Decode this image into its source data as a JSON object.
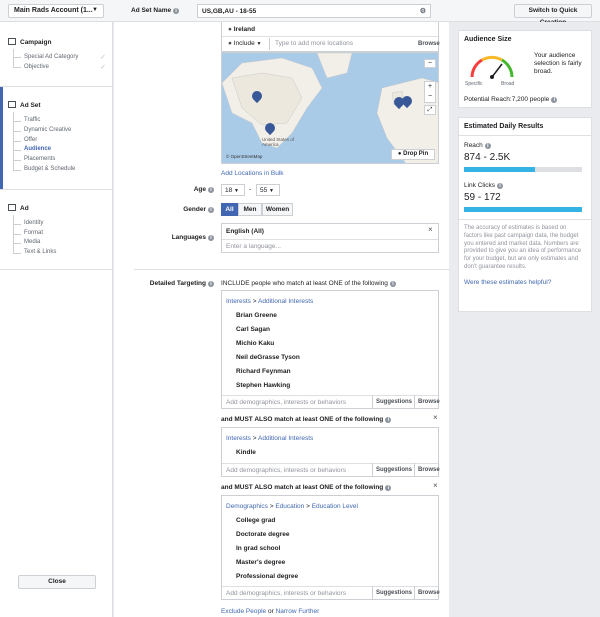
{
  "header": {
    "account": "Main Rads Account (1...",
    "adset_name_label": "Ad Set Name",
    "adset_name_value": "US,GB,AU - 18-55",
    "quick_creation": "Switch to Quick Creation"
  },
  "sidebar": {
    "campaign": {
      "title": "Campaign",
      "items": [
        "Special Ad Category",
        "Objective"
      ]
    },
    "adset": {
      "title": "Ad Set",
      "items": [
        "Traffic",
        "Dynamic Creative",
        "Offer",
        "Audience",
        "Placements",
        "Budget & Schedule"
      ]
    },
    "ad": {
      "title": "Ad",
      "items": [
        "Identity",
        "Format",
        "Media",
        "Text & Links"
      ]
    },
    "close": "Close"
  },
  "locations": {
    "country": "Ireland",
    "include": "Include",
    "placeholder": "Type to add more locations",
    "browse": "Browse",
    "add_bulk": "Add Locations in Bulk",
    "drop_pin": "Drop Pin",
    "map_credit": "© OpenStreetMap",
    "map_label": "United States of America"
  },
  "age": {
    "label": "Age",
    "min": "18",
    "sep": "-",
    "max": "55"
  },
  "gender": {
    "label": "Gender",
    "options": [
      "All",
      "Men",
      "Women"
    ]
  },
  "languages": {
    "label": "Languages",
    "value": "English (All)",
    "placeholder": "Enter a language..."
  },
  "targeting": {
    "label": "Detailed Targeting",
    "include_text": "INCLUDE people who match at least ONE of the following",
    "group1": {
      "path_a": "Interests",
      "path_sep": ">",
      "path_b": "Additional Interests",
      "items": [
        "Brian Greene",
        "Carl Sagan",
        "Michio Kaku",
        "Neil deGrasse Tyson",
        "Richard Feynman",
        "Stephen Hawking"
      ]
    },
    "input_placeholder": "Add demographics, interests or behaviors",
    "suggestions": "Suggestions",
    "browse": "Browse",
    "must_text": "and MUST ALSO match at least ONE of the following",
    "group2": {
      "path_a": "Interests",
      "path_sep": ">",
      "path_b": "Additional Interests",
      "items": [
        "Kindle"
      ]
    },
    "group3": {
      "path_a": "Demographics",
      "path_sep1": ">",
      "path_b": "Education",
      "path_sep2": ">",
      "path_c": "Education Level",
      "items": [
        "College grad",
        "Doctorate degree",
        "In grad school",
        "Master's degree",
        "Professional degree"
      ]
    },
    "exclude": "Exclude People",
    "or": "or",
    "narrow": "Narrow Further"
  },
  "audience_size": {
    "title": "Audience Size",
    "description": "Your audience selection is fairly broad.",
    "specific": "Specific",
    "broad": "Broad",
    "potential_reach": "Potential Reach:7,200 people"
  },
  "daily_results": {
    "title": "Estimated Daily Results",
    "reach_label": "Reach",
    "reach_value": "874 - 2.5K",
    "reach_fill": 0.6,
    "clicks_label": "Link Clicks",
    "clicks_value": "59 - 172",
    "clicks_fill": 1.0,
    "disclaimer": "The accuracy of estimates is based on factors like past campaign data, the budget you entered and market data. Numbers are provided to give you an idea of performance for your budget, but are only estimates and don't guarantee results.",
    "help_link": "Were these estimates helpful?"
  },
  "colors": {
    "accent": "#4267b2",
    "bar": "#34b3e4",
    "gauge_green": "#42b72a",
    "gauge_yellow": "#f7b928",
    "gauge_red": "#fa3e3e"
  }
}
